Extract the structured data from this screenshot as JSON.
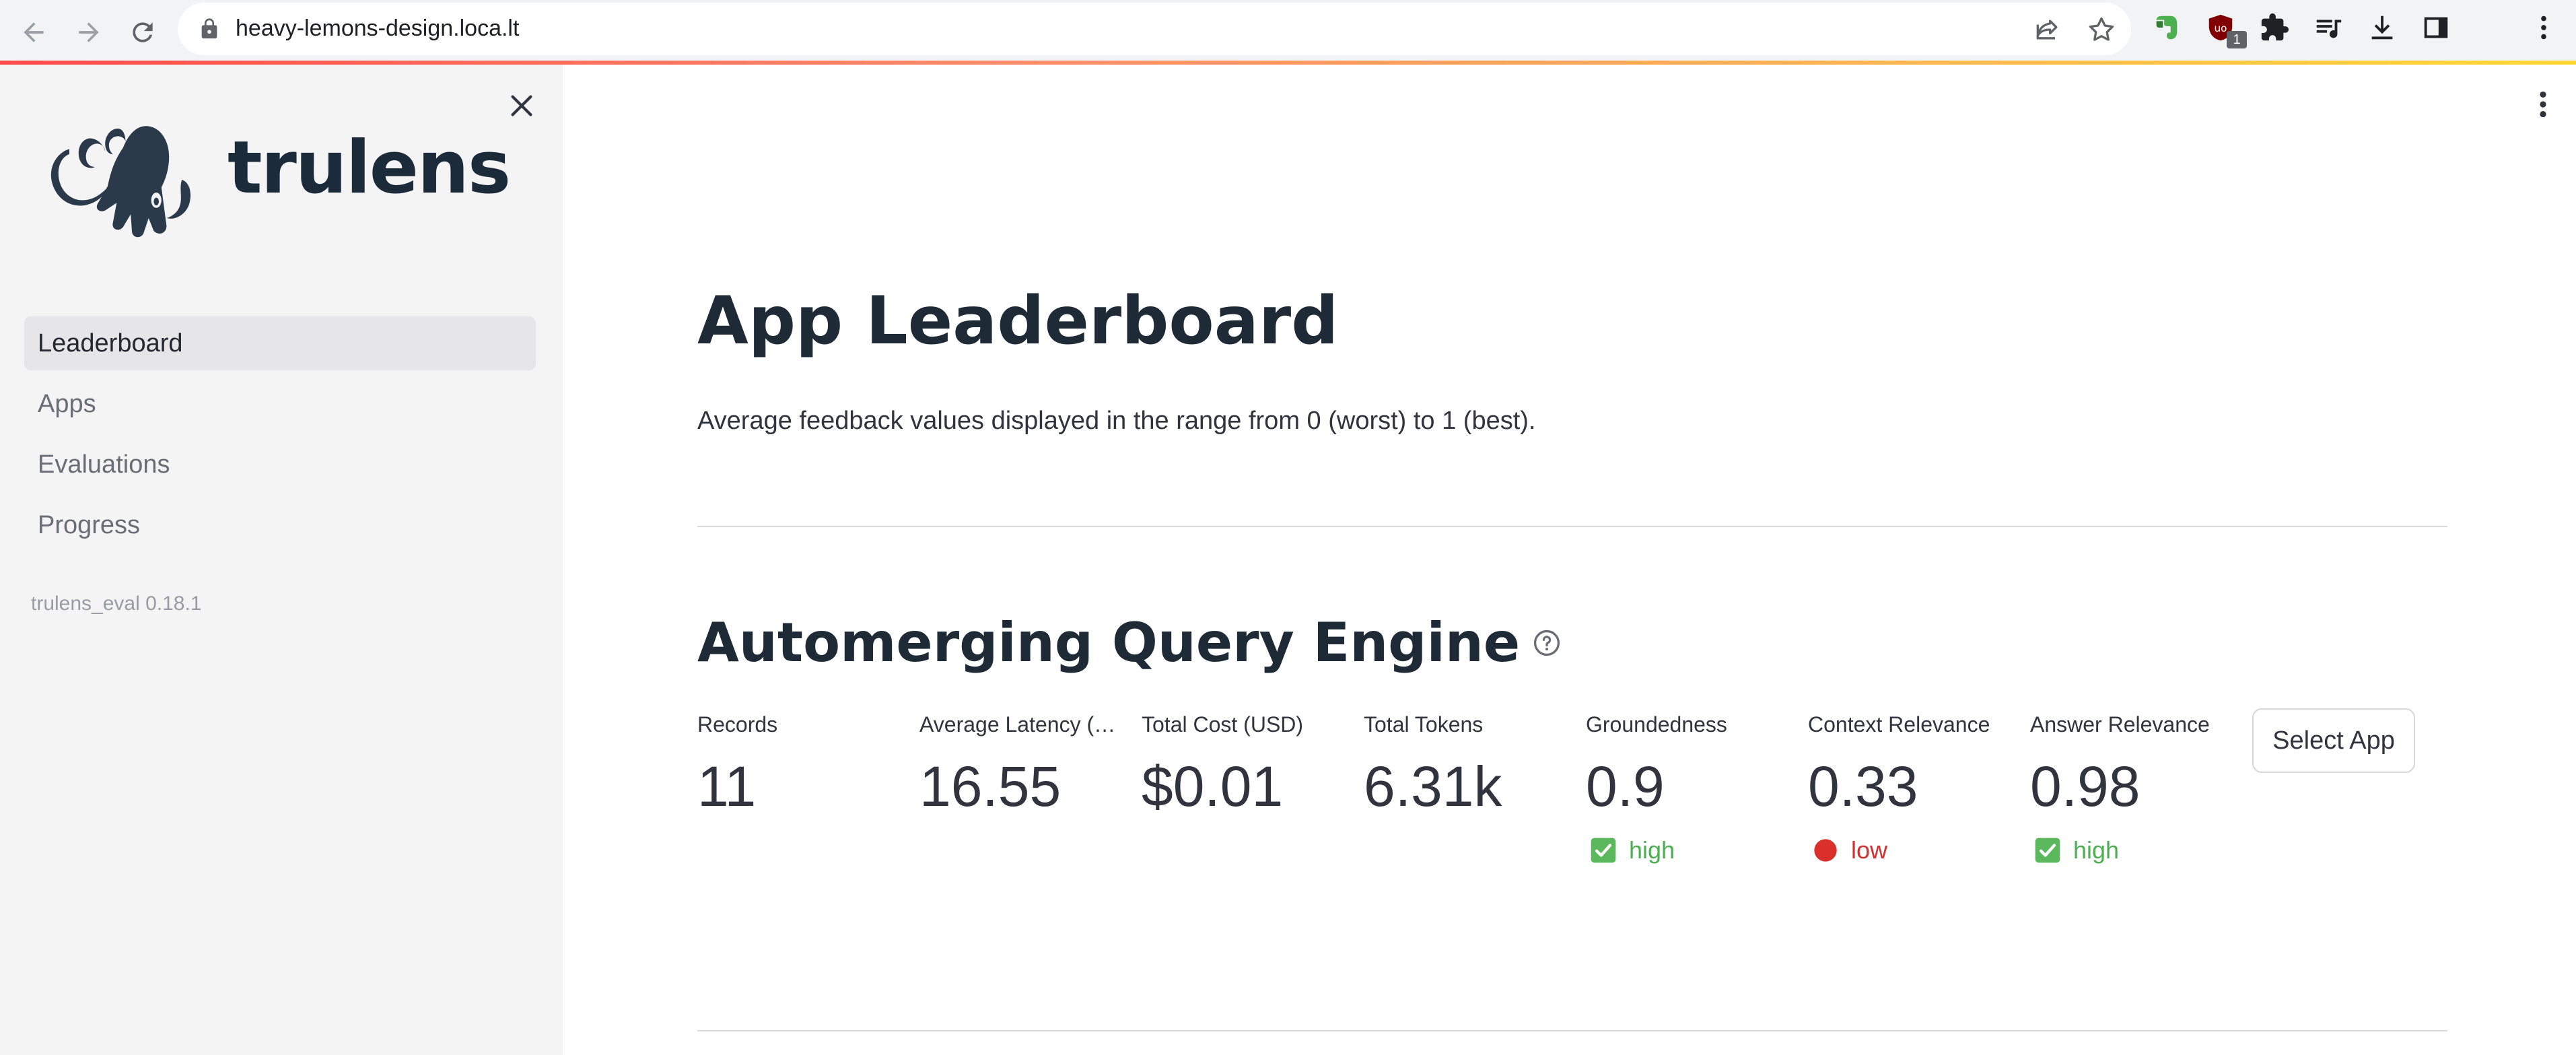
{
  "browser": {
    "url": "heavy-lemons-design.loca.lt",
    "extension_badge": "1",
    "icons": [
      "back-arrow-icon",
      "forward-arrow-icon",
      "reload-icon",
      "lock-icon",
      "share-icon",
      "star-icon",
      "evernote-icon",
      "ublock-icon",
      "puzzle-icon",
      "playlist-icon",
      "download-icon",
      "side-panel-icon",
      "kebab-menu-icon"
    ]
  },
  "sidebar": {
    "brand": "trulens",
    "items": [
      {
        "label": "Leaderboard",
        "active": true
      },
      {
        "label": "Apps",
        "active": false
      },
      {
        "label": "Evaluations",
        "active": false
      },
      {
        "label": "Progress",
        "active": false
      }
    ],
    "version": "trulens_eval 0.18.1"
  },
  "main": {
    "title": "App Leaderboard",
    "subtitle": "Average feedback values displayed in the range from 0 (worst) to 1 (best).",
    "app": {
      "name": "Automerging Query Engine",
      "metrics": [
        {
          "label": "Records",
          "value": "11"
        },
        {
          "label": "Average Latency (…",
          "value": "16.55"
        },
        {
          "label": "Total Cost (USD)",
          "value": "$0.01"
        },
        {
          "label": "Total Tokens",
          "value": "6.31k"
        },
        {
          "label": "Groundedness",
          "value": "0.9",
          "status": "high"
        },
        {
          "label": "Context Relevance",
          "value": "0.33",
          "status": "low"
        },
        {
          "label": "Answer Relevance",
          "value": "0.98",
          "status": "high"
        }
      ],
      "select_button": "Select App"
    }
  },
  "colors": {
    "high": "#4caf50",
    "low": "#d32f2f",
    "sidebar_bg": "#f4f4f5",
    "accent": "#ff4b4b"
  }
}
